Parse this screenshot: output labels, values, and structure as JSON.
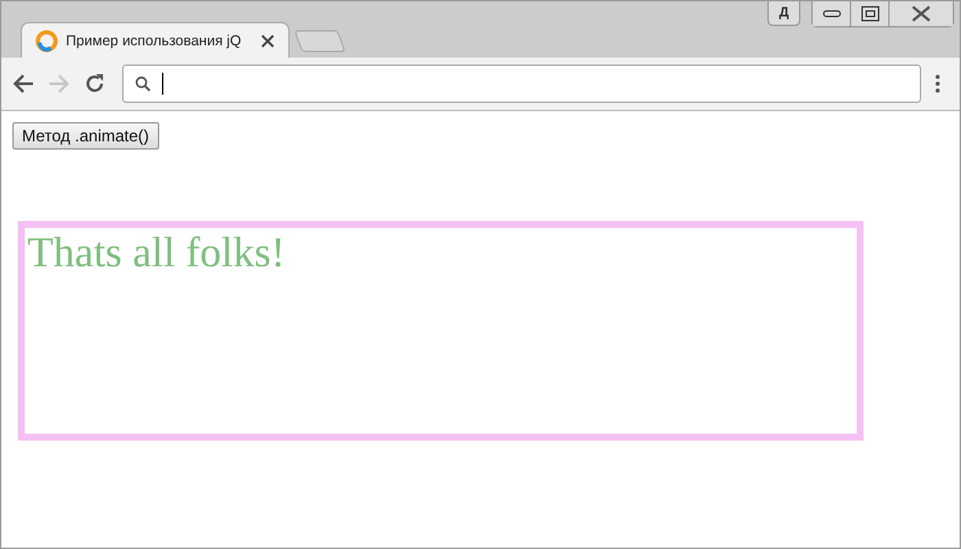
{
  "titlebar": {
    "profile": "Д"
  },
  "tabs": [
    {
      "title": "Пример использования jQ",
      "selected": true
    }
  ],
  "nav_buttons": [
    {
      "kind": "back",
      "disabled": false
    },
    {
      "kind": "forward",
      "disabled": true
    },
    {
      "kind": "reload",
      "disabled": false
    }
  ],
  "page": {
    "button": "Метод .animate()",
    "box_text": "Thats all folks!"
  }
}
